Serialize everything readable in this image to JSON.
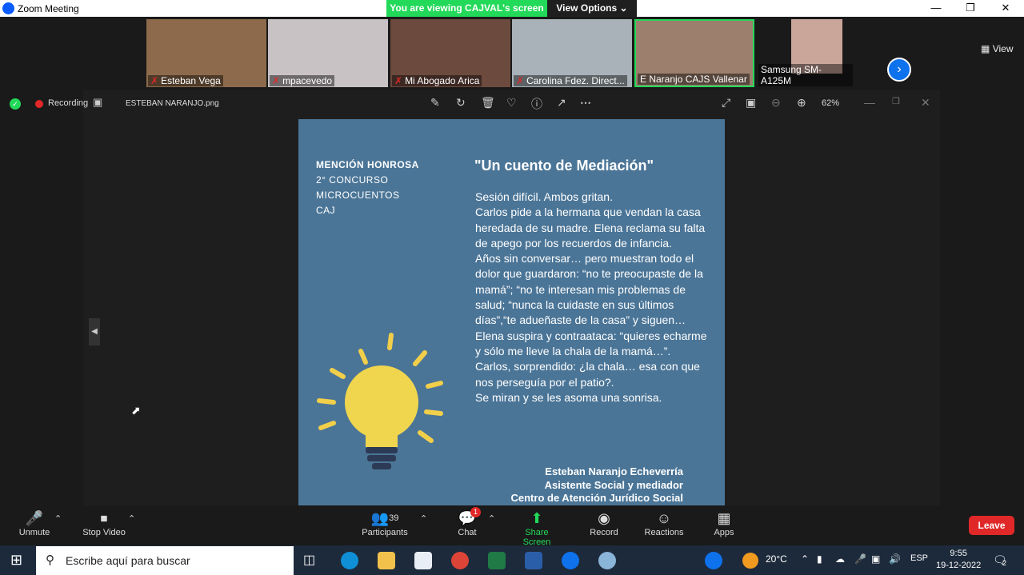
{
  "window": {
    "title": "Zoom Meeting"
  },
  "share_banner": {
    "text": "You are viewing CAJVAL's screen",
    "view_options": "View Options"
  },
  "participants": [
    {
      "name": "Esteban Vega",
      "muted": true
    },
    {
      "name": "mpacevedo",
      "muted": true
    },
    {
      "name": "Mi Abogado Arica",
      "muted": true
    },
    {
      "name": "Carolina Fdez. Direct...",
      "muted": true
    },
    {
      "name": "E Naranjo CAJS Vallenar",
      "muted": false
    },
    {
      "name": "Samsung SM-A125M",
      "muted": false
    }
  ],
  "view_button": "View",
  "viewer": {
    "recording_label": "Recording",
    "filename": "ESTEBAN NARANJO.png",
    "zoom": "62%"
  },
  "slide": {
    "mention_line1": "MENCIÓN HONROSA",
    "mention_line2": "2° CONCURSO",
    "mention_line3": "MICROCUENTOS",
    "mention_line4": "CAJ",
    "title": "\"Un cuento de Mediación\"",
    "story": "Sesión difícil. Ambos gritan.\nCarlos pide a la hermana que vendan la casa heredada de su madre. Elena reclama su falta de apego por los recuerdos de infancia.\nAños sin conversar… pero muestran todo el dolor que guardaron: “no te preocupaste de la mamá”; “no te interesan mis problemas de salud; “nunca la cuidaste en sus últimos días”,“te adueñaste de la casa” y siguen…\nElena suspira y contraataca: “quieres echarme y sólo me lleve la chala de la mamá…”.\nCarlos, sorprendido: ¿la chala… esa con que nos perseguía por el patio?.\nSe miran y se les asoma una sonrisa.",
    "author_name": "Esteban Naranjo Echeverría",
    "author_role": "Asistente Social y mediador",
    "author_org": "Centro de Atención Jurídico Social"
  },
  "controls": {
    "unmute": "Unmute",
    "stop_video": "Stop Video",
    "participants": "Participants",
    "participants_count": "39",
    "chat": "Chat",
    "chat_badge": "1",
    "share_screen": "Share Screen",
    "record": "Record",
    "reactions": "Reactions",
    "apps": "Apps",
    "leave": "Leave"
  },
  "taskbar": {
    "search_placeholder": "Escribe aquí para buscar",
    "temperature": "20°C",
    "language": "ESP",
    "time": "9:55",
    "date": "19-12-2022",
    "notifications": "2"
  },
  "colors": {
    "accent": "#0e72ed",
    "green": "#23d959",
    "red": "#e02828",
    "slide_bg": "#4b7597"
  }
}
